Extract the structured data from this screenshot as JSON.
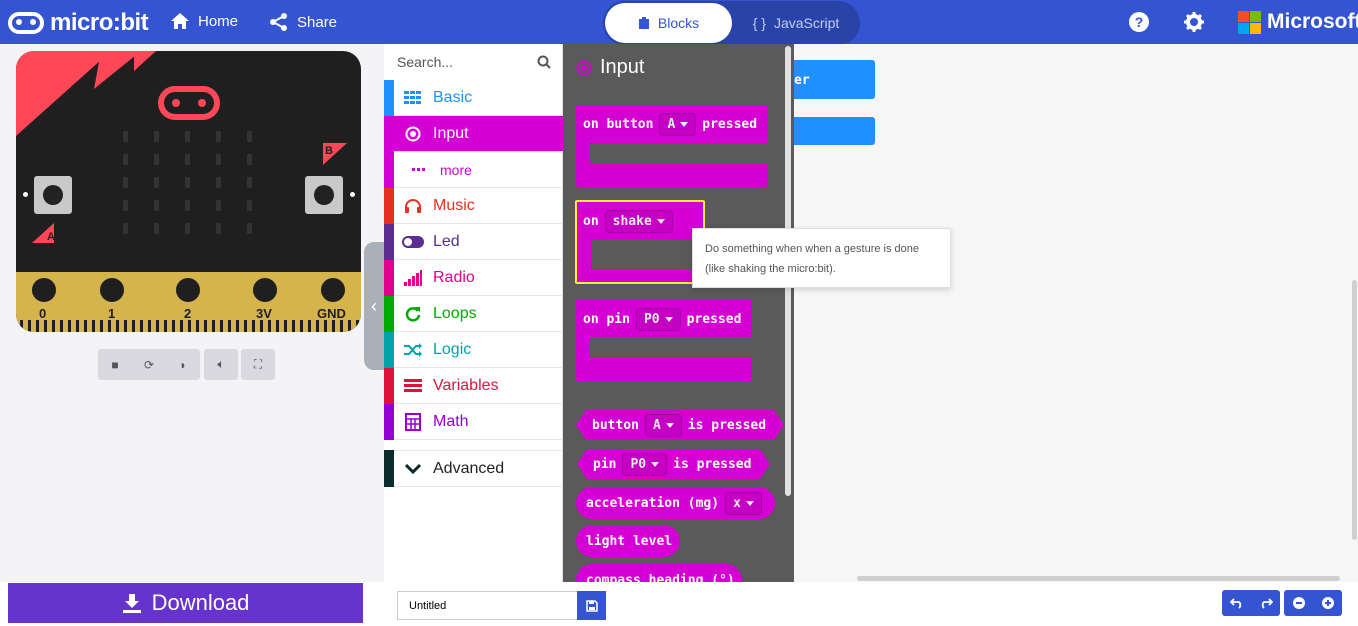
{
  "header": {
    "brand": "micro:bit",
    "nav": {
      "home": "Home",
      "share": "Share"
    },
    "modes": {
      "blocks": "Blocks",
      "javascript": "JavaScript"
    },
    "icons": {
      "help": "help-icon",
      "settings": "gear-icon"
    },
    "vendor": "Microsoft",
    "vendor_colors": [
      "#f25022",
      "#7fba00",
      "#00a4ef",
      "#ffb900"
    ]
  },
  "simulator": {
    "button_labels": {
      "a": "A",
      "b": "B"
    },
    "pins": [
      "0",
      "1",
      "2",
      "3V",
      "GND"
    ],
    "controls": [
      "stop-icon",
      "restart-icon",
      "slow-motion-icon",
      "sound-icon",
      "fullscreen-icon"
    ]
  },
  "toolbox": {
    "search_placeholder": "Search...",
    "categories": [
      {
        "label": "Basic",
        "color": "#1e90ff"
      },
      {
        "label": "Input",
        "color": "#d400d4"
      },
      {
        "label": "more",
        "color": "#d400d4"
      },
      {
        "label": "Music",
        "color": "#e63022"
      },
      {
        "label": "Led",
        "color": "#5c2d91"
      },
      {
        "label": "Radio",
        "color": "#e3008c"
      },
      {
        "label": "Loops",
        "color": "#00aa00"
      },
      {
        "label": "Logic",
        "color": "#00a4a6"
      },
      {
        "label": "Variables",
        "color": "#dc143c"
      },
      {
        "label": "Math",
        "color": "#9400d3"
      }
    ],
    "advanced": "Advanced"
  },
  "flyout": {
    "title": "Input",
    "color": "#d400d4",
    "blocks": {
      "on_button": {
        "prefix": "on button",
        "value": "A",
        "suffix": "pressed"
      },
      "on_gesture": {
        "prefix": "on",
        "value": "shake"
      },
      "on_pin": {
        "prefix": "on pin",
        "value": "P0",
        "suffix": "pressed"
      },
      "button_pressed": {
        "prefix": "button",
        "value": "A",
        "suffix": "is pressed"
      },
      "pin_pressed": {
        "prefix": "pin",
        "value": "P0",
        "suffix": "is pressed"
      },
      "acceleration": {
        "prefix": "acceleration (mg)",
        "value": "x"
      },
      "light_level": "light level",
      "compass": "compass heading (°)"
    }
  },
  "workspace": {
    "partial_block_text": "er"
  },
  "tooltip": "Do something when when a gesture is done (like shaking the micro:bit).",
  "footer": {
    "download": "Download",
    "project_name": "Untitled"
  }
}
